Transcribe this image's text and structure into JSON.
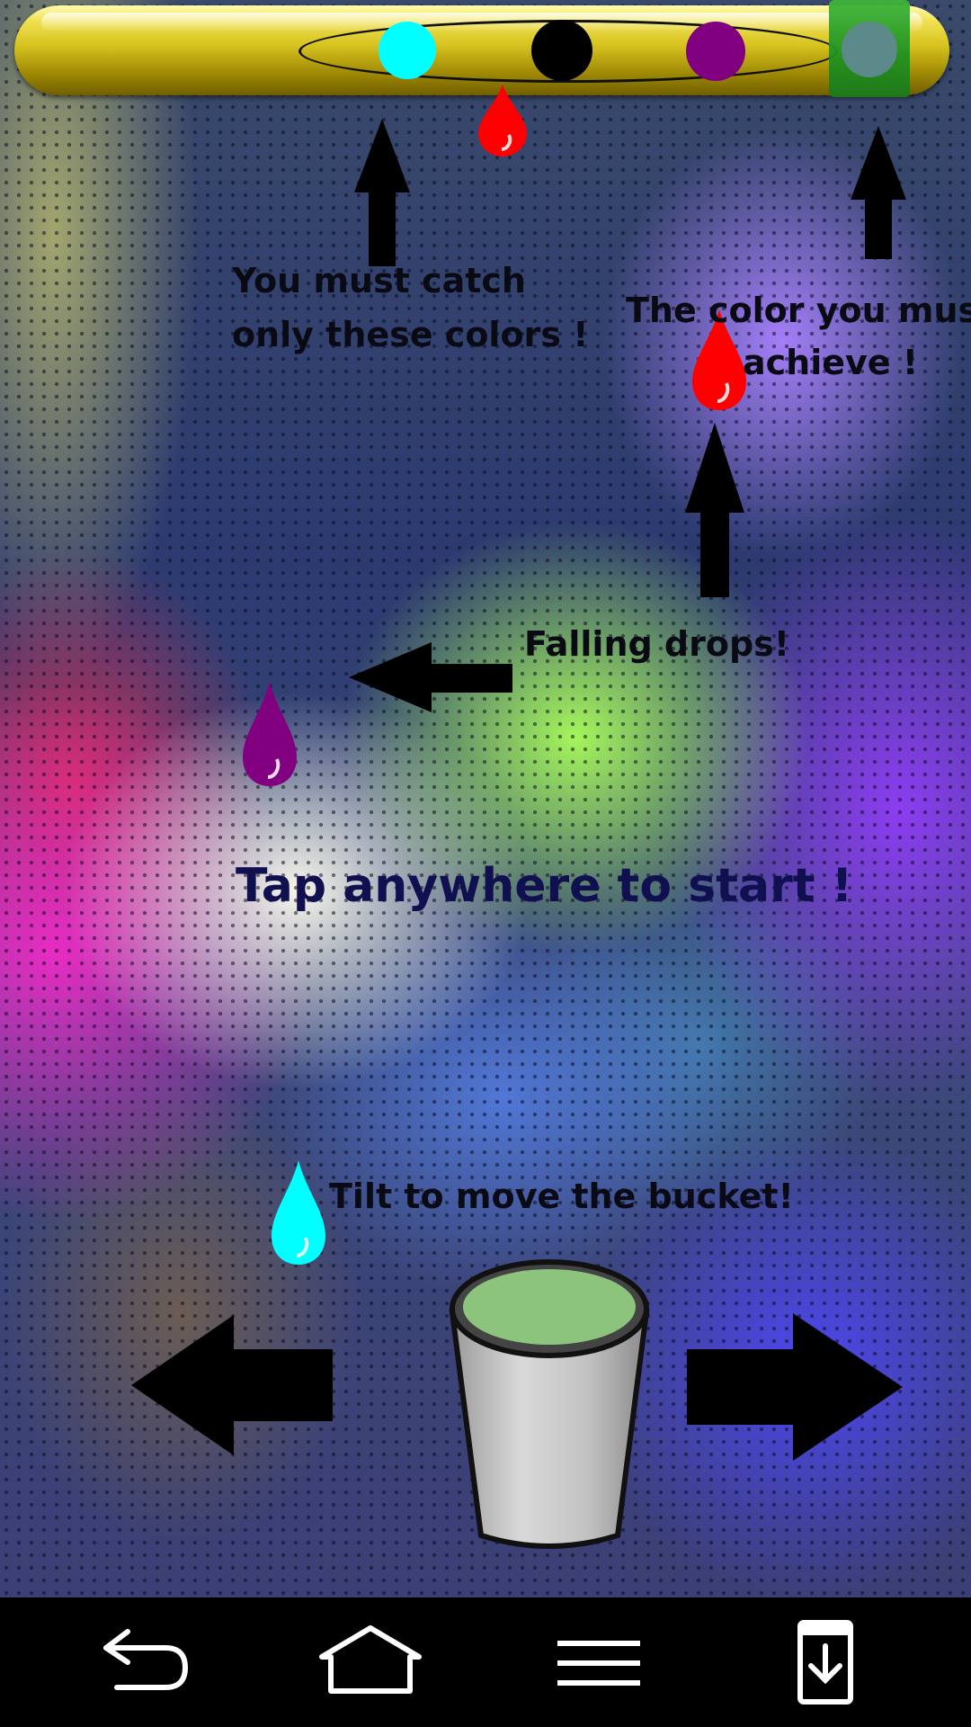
{
  "game": {
    "hints": {
      "catch_line1": "You must catch",
      "catch_line2": "only these colors !",
      "target_line1": "The color you must",
      "target_line2": "achieve !",
      "falling": "Falling drops!",
      "tilt": "Tilt to move the bucket!"
    },
    "start_prompt": "Tap anywhere to start !",
    "catch_colors": [
      {
        "name": "cyan",
        "hex": "#00ffff"
      },
      {
        "name": "black",
        "hex": "#000000"
      },
      {
        "name": "purple",
        "hex": "#800080"
      }
    ],
    "target_color": {
      "name": "target",
      "hex": "#5c8a8a"
    },
    "bucket_fill": "#8cc47e",
    "drops": [
      {
        "name": "red",
        "hex": "#ff0000"
      },
      {
        "name": "purple",
        "hex": "#800080"
      },
      {
        "name": "cyan",
        "hex": "#00ffff"
      }
    ]
  },
  "navbar": {
    "buttons": [
      "back-icon",
      "home-icon",
      "menu-icon",
      "notification-tray-icon"
    ]
  }
}
